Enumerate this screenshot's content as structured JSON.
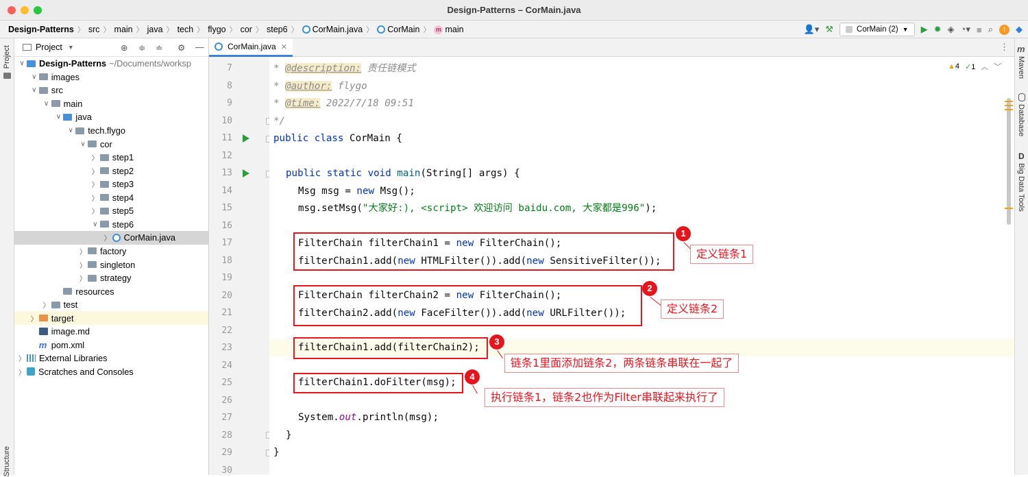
{
  "window": {
    "title": "Design-Patterns – CorMain.java"
  },
  "breadcrumbs": [
    "Design-Patterns",
    "src",
    "main",
    "java",
    "tech",
    "flygo",
    "cor",
    "step6",
    "CorMain.java",
    "CorMain",
    "main"
  ],
  "toolbar": {
    "run_config": "CorMain (2)"
  },
  "project_panel": {
    "title": "Project",
    "tree": [
      {
        "label": "Design-Patterns",
        "suffix": "~/Documents/worksp",
        "depth": 0,
        "expanded": true,
        "icon": "module-folder-icon"
      },
      {
        "label": "images",
        "depth": 1,
        "expanded": true,
        "icon": "folder-icon"
      },
      {
        "label": "src",
        "depth": 1,
        "expanded": true,
        "icon": "folder-icon"
      },
      {
        "label": "main",
        "depth": 2,
        "expanded": true,
        "icon": "folder-icon"
      },
      {
        "label": "java",
        "depth": 3,
        "expanded": true,
        "icon": "source-folder-icon"
      },
      {
        "label": "tech.flygo",
        "depth": 4,
        "expanded": true,
        "icon": "package-icon"
      },
      {
        "label": "cor",
        "depth": 5,
        "expanded": true,
        "icon": "package-icon"
      },
      {
        "label": "step1",
        "depth": 6,
        "expanded": false,
        "icon": "package-icon"
      },
      {
        "label": "step2",
        "depth": 6,
        "expanded": false,
        "icon": "package-icon"
      },
      {
        "label": "step3",
        "depth": 6,
        "expanded": false,
        "icon": "package-icon"
      },
      {
        "label": "step4",
        "depth": 6,
        "expanded": false,
        "icon": "package-icon"
      },
      {
        "label": "step5",
        "depth": 6,
        "expanded": false,
        "icon": "package-icon"
      },
      {
        "label": "step6",
        "depth": 6,
        "expanded": true,
        "icon": "package-icon"
      },
      {
        "label": "CorMain.java",
        "depth": 7,
        "expanded": false,
        "icon": "java-class-icon",
        "selected": true
      },
      {
        "label": "factory",
        "depth": 5,
        "expanded": false,
        "icon": "package-icon"
      },
      {
        "label": "singleton",
        "depth": 5,
        "expanded": false,
        "icon": "package-icon"
      },
      {
        "label": "strategy",
        "depth": 5,
        "expanded": false,
        "icon": "package-icon"
      },
      {
        "label": "resources",
        "depth": 3,
        "expanded": null,
        "icon": "resources-folder-icon"
      },
      {
        "label": "test",
        "depth": 2,
        "expanded": false,
        "icon": "folder-icon"
      },
      {
        "label": "target",
        "depth": 1,
        "expanded": false,
        "icon": "target-folder-icon",
        "highlighted": true
      },
      {
        "label": "image.md",
        "depth": 1,
        "expanded": null,
        "icon": "markdown-file-icon"
      },
      {
        "label": "pom.xml",
        "depth": 1,
        "expanded": null,
        "icon": "maven-file-icon"
      },
      {
        "label": "External Libraries",
        "depth": 0,
        "expanded": false,
        "icon": "libraries-icon"
      },
      {
        "label": "Scratches and Consoles",
        "depth": 0,
        "expanded": false,
        "icon": "scratches-icon"
      }
    ]
  },
  "editor": {
    "tab": "CorMain.java",
    "warnings": "4",
    "weak_warnings": "1",
    "lines": [
      {
        "n": "7"
      },
      {
        "n": "8"
      },
      {
        "n": "9"
      },
      {
        "n": "10"
      },
      {
        "n": "11"
      },
      {
        "n": "12"
      },
      {
        "n": "13"
      },
      {
        "n": "14"
      },
      {
        "n": "15"
      },
      {
        "n": "16"
      },
      {
        "n": "17"
      },
      {
        "n": "18"
      },
      {
        "n": "19"
      },
      {
        "n": "20"
      },
      {
        "n": "21"
      },
      {
        "n": "22"
      },
      {
        "n": "23"
      },
      {
        "n": "24"
      },
      {
        "n": "25"
      },
      {
        "n": "26"
      },
      {
        "n": "27"
      },
      {
        "n": "28"
      },
      {
        "n": "29"
      },
      {
        "n": "30"
      }
    ],
    "code": {
      "l7_tag": "@description:",
      "l7_text": " 责任链模式",
      "l8_tag": "@author:",
      "l8_text": " flygo",
      "l9_tag": "@time:",
      "l9_text": " 2022/7/18 09:51",
      "l10": "*/",
      "l11_class": "CorMain {",
      "l13_main": "main",
      "l13_rest": "(String[] args) {",
      "l14_a": "Msg msg = ",
      "l14_b": "Msg();",
      "l15_a": "msg.setMsg(",
      "l15_str": "\"大家好:), <script> 欢迎访问 baidu.com, 大家都是996\"",
      "l15_b": ");",
      "l17_a": "FilterChain filterChain1 = ",
      "l17_b": "FilterChain();",
      "l18_a": "filterChain1.add(",
      "l18_b": "HTMLFilter()).add(",
      "l18_c": "SensitiveFilter());",
      "l20_a": "FilterChain filterChain2 = ",
      "l20_b": "FilterChain();",
      "l21_a": "filterChain2.add(",
      "l21_b": "FaceFilter()).add(",
      "l21_c": "URLFilter());",
      "l23": "filterChain1.add(filterChain2);",
      "l25": "filterChain1.doFilter(msg);",
      "l27_a": "System.",
      "l27_out": "out",
      "l27_b": ".println(msg);",
      "l28": "}",
      "l29": "}"
    }
  },
  "annotations": [
    {
      "num": "1",
      "text": "定义链条1"
    },
    {
      "num": "2",
      "text": "定义链条2"
    },
    {
      "num": "3",
      "text": "链条1里面添加链条2，两条链条串联在一起了"
    },
    {
      "num": "4",
      "text": "执行链条1，链条2也作为Filter串联起来执行了"
    }
  ],
  "side_tools": {
    "left": [
      "Project",
      "Structure"
    ],
    "right": [
      "Maven",
      "Database",
      "Big Data Tools"
    ]
  },
  "colors": {
    "annotation_red": "#e5151e",
    "keyword_blue": "#0033b3",
    "string_green": "#067d17"
  }
}
